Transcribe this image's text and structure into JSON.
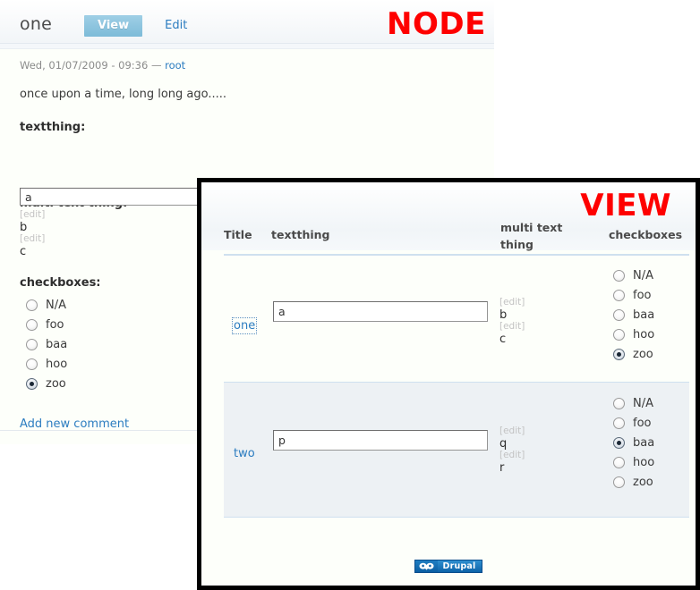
{
  "node_page": {
    "overlay_label": "NODE",
    "title": "one",
    "tabs": [
      {
        "label": "View",
        "state": "active"
      },
      {
        "label": "Edit",
        "state": "inactive"
      }
    ],
    "submitted": {
      "datetime": "Wed, 01/07/2009 - 09:36",
      "separator": "—",
      "author": "root"
    },
    "body": "once upon a time, long long ago.....",
    "fields": {
      "textthing": {
        "label": "textthing:",
        "value": "a"
      },
      "multi_text_thing": {
        "label": "multi text thing:",
        "items": [
          {
            "edit_label": "[edit]",
            "value": "b"
          },
          {
            "edit_label": "[edit]",
            "value": "c"
          }
        ]
      },
      "checkboxes": {
        "label": "checkboxes:",
        "options": [
          {
            "label": "N/A",
            "checked": false
          },
          {
            "label": "foo",
            "checked": false
          },
          {
            "label": "baa",
            "checked": false
          },
          {
            "label": "hoo",
            "checked": false
          },
          {
            "label": "zoo",
            "checked": true
          }
        ]
      }
    },
    "add_comment_label": "Add new comment"
  },
  "view_panel": {
    "overlay_label": "VIEW",
    "table": {
      "columns": [
        "Title",
        "textthing",
        "multi text thing",
        "checkboxes"
      ],
      "rows": [
        {
          "title": "one",
          "title_focused": true,
          "textthing": "a",
          "multi": [
            {
              "edit_label": "[edit]",
              "value": "b"
            },
            {
              "edit_label": "[edit]",
              "value": "c"
            }
          ],
          "checkboxes": [
            {
              "label": "N/A",
              "checked": false
            },
            {
              "label": "foo",
              "checked": false
            },
            {
              "label": "baa",
              "checked": false
            },
            {
              "label": "hoo",
              "checked": false
            },
            {
              "label": "zoo",
              "checked": true
            }
          ]
        },
        {
          "title": "two",
          "title_focused": false,
          "textthing": "p",
          "multi": [
            {
              "edit_label": "[edit]",
              "value": "q"
            },
            {
              "edit_label": "[edit]",
              "value": "r"
            }
          ],
          "checkboxes": [
            {
              "label": "N/A",
              "checked": false
            },
            {
              "label": "foo",
              "checked": false
            },
            {
              "label": "baa",
              "checked": true
            },
            {
              "label": "hoo",
              "checked": false
            },
            {
              "label": "zoo",
              "checked": false
            }
          ]
        }
      ]
    },
    "footer": {
      "badge_text": "Drupal"
    }
  },
  "colors": {
    "overlay_red": "#fe0000",
    "link_blue": "#2b7cc0",
    "active_tab_blue": "#7dbbd8",
    "row_stripe": "#edf1f4",
    "panel_border": "#000000"
  }
}
